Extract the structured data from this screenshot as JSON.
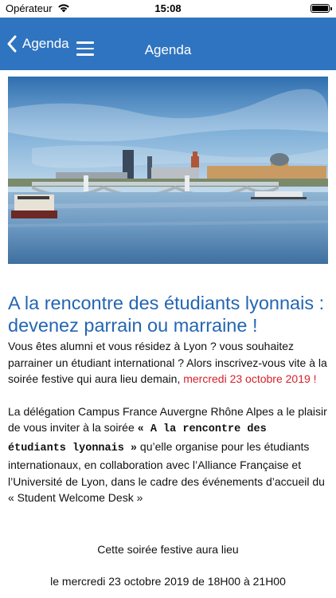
{
  "status_bar": {
    "carrier": "Opérateur",
    "time": "15:08"
  },
  "nav": {
    "back_label": "Agenda",
    "title": "Agenda"
  },
  "hero": {
    "description": ""
  },
  "article": {
    "title": "A la rencontre des étudiants lyonnais : devenez parrain ou marraine !",
    "p1_text": "Vous êtes alumni et vous résidez à Lyon ? vous souhaitez parrainer un étudiant international ? Alors inscrivez-vous vite à la soirée festive qui aura lieu demain, ",
    "p1_date": "mercredi 23 octobre 2019 !",
    "p2_a": "La délégation Campus France Auvergne Rhône Alpes a le plaisir de vous inviter à la soirée ",
    "p2_event": "« A la rencontre des étudiants lyonnais »",
    "p2_b": " qu’elle organise pour les étudiants internationaux, en collaboration avec l’Alliance Française et l’Université de Lyon, dans le cadre  des événements d’accueil du « Student Welcome Desk »",
    "p3": "Cette soirée festive  aura lieu",
    "p4": "le mercredi 23 octobre 2019 de 18H00 à 21H00"
  }
}
